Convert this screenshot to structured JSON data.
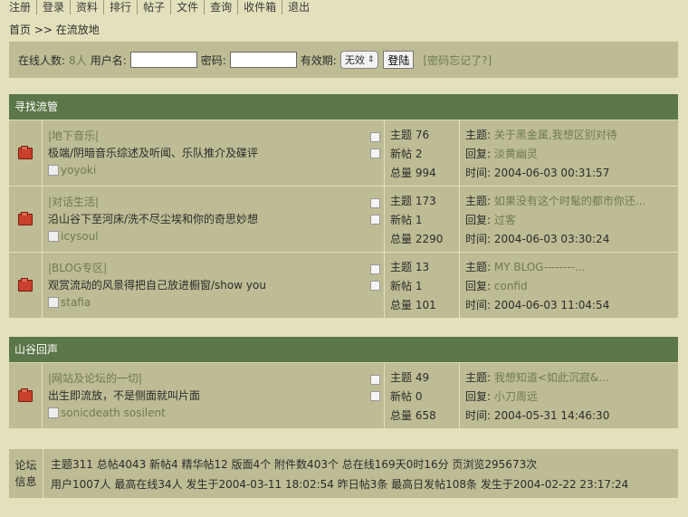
{
  "nav": [
    "注册",
    "登录",
    "资料",
    "排行",
    "帖子",
    "文件",
    "查询",
    "收件箱",
    "退出"
  ],
  "breadcrumb": "首页 >> 在流放地",
  "login": {
    "online_label": "在线人数:",
    "online_count": "8人",
    "username_label": "用户名:",
    "password_label": "密码:",
    "expiry_label": "有效期:",
    "expiry_value": "无效",
    "submit_label": "登陆",
    "forgot_label": "[密码忘记了?]"
  },
  "sections": [
    {
      "title": "寻找流管",
      "forums": [
        {
          "name": "|地下音乐|",
          "desc": "极端/阴暗音乐综述及听闻、乐队推介及碟评",
          "moderator": "yoyoki",
          "stats": [
            "主题 76",
            "新帖 2",
            "总量 994"
          ],
          "last": {
            "topic_label": "主题:",
            "topic": "关于黑金属,我想区别对待",
            "reply_label": "回复:",
            "reply": "淡黄幽灵",
            "time_label": "时间:",
            "time": "2004-06-03 00:31:57"
          }
        },
        {
          "name": "|对话生活|",
          "desc": "沿山谷下至河床/洗不尽尘埃和你的奇思妙想",
          "moderator": "icysoul",
          "stats": [
            "主题 173",
            "新帖 1",
            "总量 2290"
          ],
          "last": {
            "topic_label": "主题:",
            "topic": "如果没有这个时髦的都市你还...",
            "reply_label": "回复:",
            "reply": "过客",
            "time_label": "时间:",
            "time": "2004-06-03 03:30:24"
          }
        },
        {
          "name": "|BLOG专区|",
          "desc": "观赏流动的风景得把自己放进橱窗/show you",
          "moderator": "stafia",
          "stats": [
            "主题 13",
            "新帖 1",
            "总量 101"
          ],
          "last": {
            "topic_label": "主题:",
            "topic": "MY BLOG--------...",
            "reply_label": "回复:",
            "reply": "confid",
            "time_label": "时间:",
            "time": "2004-06-03 11:04:54"
          }
        }
      ]
    },
    {
      "title": "山谷回声",
      "forums": [
        {
          "name": "|网站及论坛的一切|",
          "desc": "出生即流放，不是侧面就叫片面",
          "moderator": "sonicdeath sosilent",
          "stats": [
            "主题 49",
            "新帖 0",
            "总量 658"
          ],
          "last": {
            "topic_label": "主题:",
            "topic": "我想知道<如此沉寂&...",
            "reply_label": "回复:",
            "reply": "小刀周远",
            "time_label": "时间:",
            "time": "2004-05-31 14:46:30"
          }
        }
      ]
    }
  ],
  "footer": {
    "label": "论坛信息",
    "line1": "主题311  总帖4043  新帖4  精华帖12  版面4个  附件数403个  总在线169天0时16分  页浏览295673次",
    "line2": "用户1007人  最高在线34人  发生于2004-03-11 18:02:54  昨日帖3条  最高日发帖108条  发生于2004-02-22 23:17:24"
  },
  "colors": {
    "background": "#e3e1bb",
    "row": "#bdbc94",
    "header": "#5b7648",
    "link": "#6f7c4f"
  }
}
